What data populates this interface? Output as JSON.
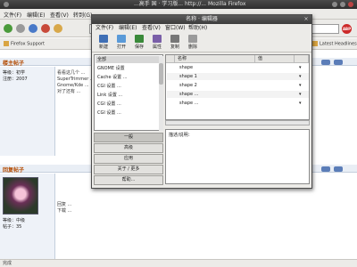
{
  "browser": {
    "title": "...高手 国 · 学习版... http://... Mozilla Firefox",
    "menu": [
      "文件(F)",
      "编辑(E)",
      "查看(V)",
      "转到(G)",
      "书签(B)",
      "工具(T)",
      "帮助(H)"
    ],
    "bookmarks": [
      "Firefox Support",
      "Firefox 帮助",
      "Plugin FAQ",
      "Firefox 扩展",
      "最近 Firefox 新闻",
      "Latest Headlines"
    ],
    "adblock_label": "ABP",
    "status_text": "完成"
  },
  "forum": {
    "posts": [
      {
        "poster": "楼主帖子",
        "left_lines": [
          "等级：初学",
          "注册：2007"
        ],
        "body": [
          "看看这几个 ...",
          "SuperTrimmer ...",
          "Gnome/Kde  ...",
          "对了还有 ..."
        ]
      },
      {
        "poster": "回复帖子",
        "left_lines": [
          "等级：中级",
          "帖子：35"
        ],
        "body": [
          "回复 ...",
          "下载 ..."
        ]
      }
    ]
  },
  "dialog": {
    "title": "名称  ·  编辑器",
    "close": "×",
    "menu": [
      "文件(F)",
      "编辑(E)",
      "查看(V)",
      "窗口(W)",
      "帮助(H)"
    ],
    "toolbar": [
      {
        "label": "新建",
        "icon": "new-icon",
        "color": "#3f6fb5"
      },
      {
        "label": "打开",
        "icon": "open-icon",
        "color": "#5a9ad8"
      },
      {
        "label": "保存",
        "icon": "save-icon",
        "color": "#3a8a3a"
      },
      {
        "label": "属性",
        "icon": "properties-icon",
        "color": "#7a5fa8"
      },
      {
        "label": "复制",
        "icon": "copy-icon",
        "color": "#777"
      },
      {
        "label": "删除",
        "icon": "delete-icon",
        "color": "#9a9a9a"
      }
    ],
    "left_list": [
      "全部",
      "GNOME 设置",
      "Cache  设置 ...",
      "CGI 设置  ...",
      "Link  设置 ...",
      "CGI 设置  ...",
      "CGI  设置 ..."
    ],
    "left_buttons": [
      "一般",
      "高级",
      "应用",
      "关于 / 更多",
      "帮助..."
    ],
    "columns": [
      "名称",
      "值",
      ""
    ],
    "rows": [
      {
        "name": "shape",
        "value": ""
      },
      {
        "name": "shape 1",
        "value": ""
      },
      {
        "name": "shape 2",
        "value": ""
      },
      {
        "name": "shape ...",
        "value": ""
      },
      {
        "name": "shape ...",
        "value": ""
      }
    ],
    "detail_label": "描述/说明："
  }
}
